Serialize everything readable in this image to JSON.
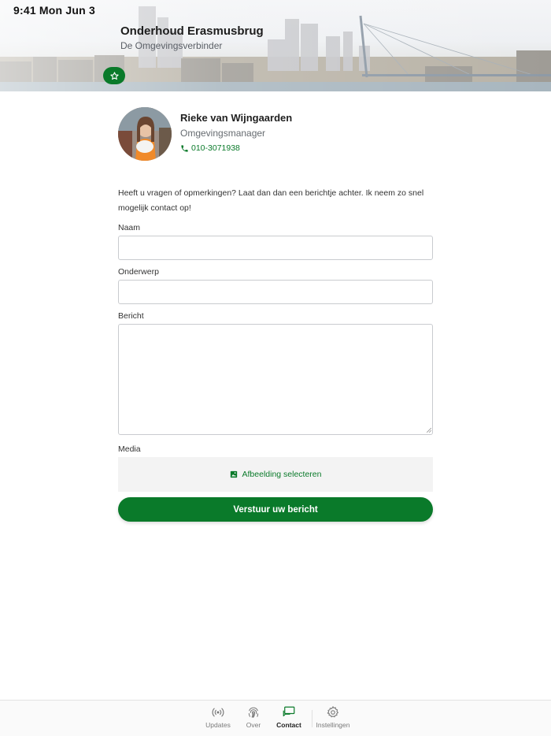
{
  "status_bar": {
    "time": "9:41  Mon Jun 3"
  },
  "header": {
    "title": "Onderhoud Erasmusbrug",
    "subtitle": "De Omgevingsverbinder"
  },
  "contact": {
    "name": "Rieke van Wijngaarden",
    "role": "Omgevingsmanager",
    "phone": "010-3071938"
  },
  "form": {
    "intro": "Heeft u vragen of opmerkingen? Laat dan dan een berichtje achter. Ik neem zo snel mogelijk contact op!",
    "name_label": "Naam",
    "name_value": "",
    "subject_label": "Onderwerp",
    "subject_value": "",
    "message_label": "Bericht",
    "message_value": "",
    "media_label": "Media",
    "select_image_label": "Afbeelding selecteren",
    "submit_label": "Verstuur uw bericht"
  },
  "tabbar": {
    "items": [
      {
        "label": "Updates",
        "icon": "broadcast-icon"
      },
      {
        "label": "Over",
        "icon": "fingerprint-icon"
      },
      {
        "label": "Contact",
        "icon": "chat-icon",
        "active": true
      },
      {
        "label": "Instellingen",
        "icon": "gear-icon"
      }
    ]
  },
  "colors": {
    "accent": "#0a7a2a"
  }
}
